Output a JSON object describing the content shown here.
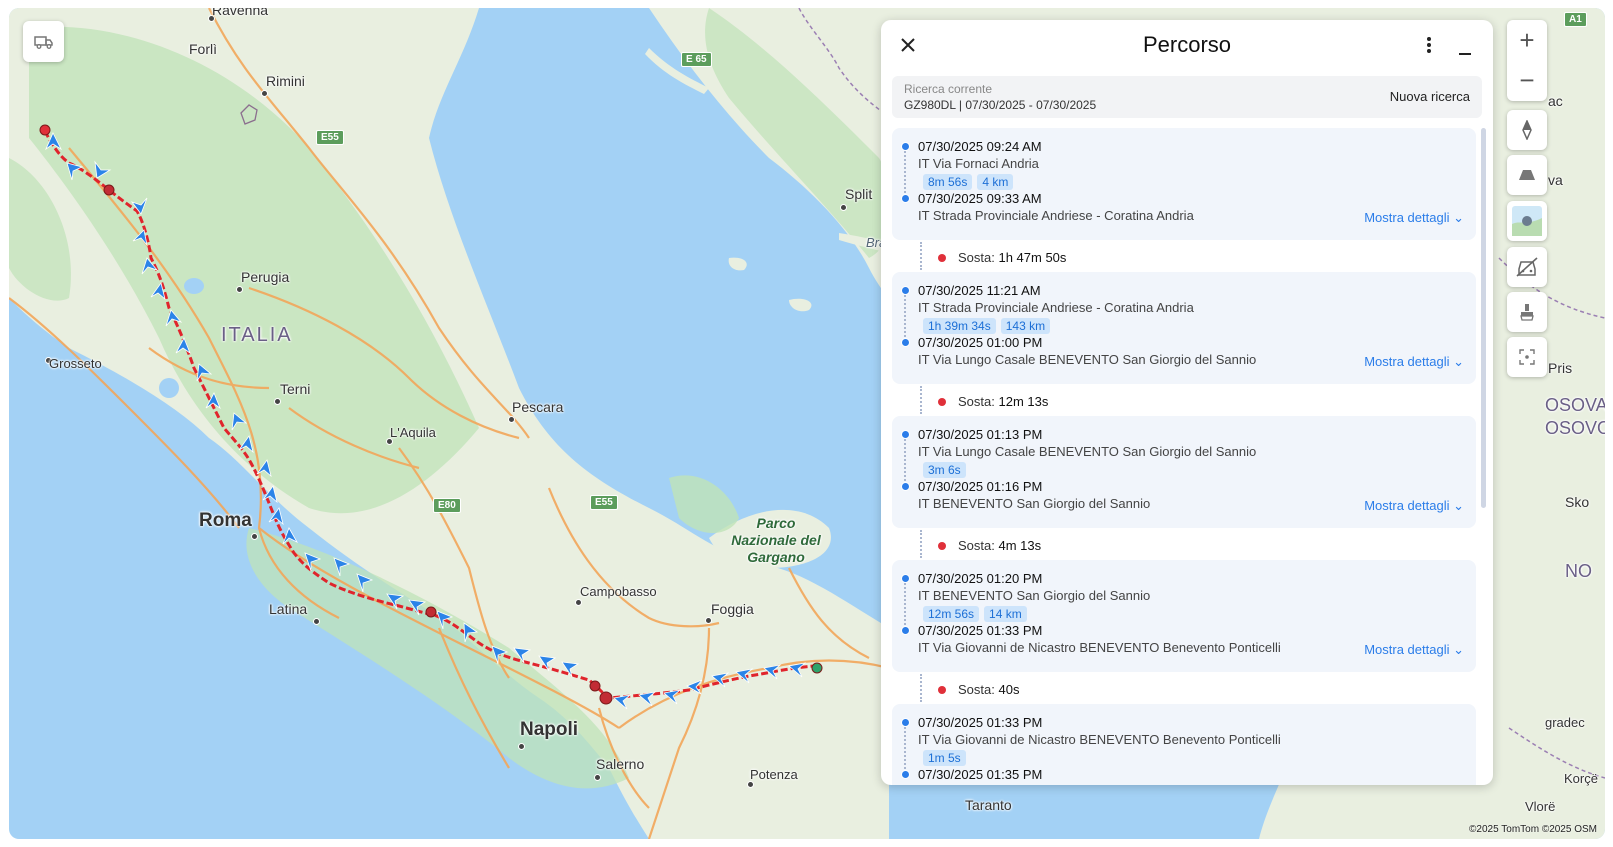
{
  "map": {
    "labels": {
      "ravenna": "Ravenna",
      "forli": "Forlì",
      "rimini": "Rimini",
      "perugia": "Perugia",
      "italia": "ITALIA",
      "grosseto": "Grosseto",
      "terni": "Terni",
      "laquila": "L'Aquila",
      "pescara": "Pescara",
      "roma": "Roma",
      "latina": "Latina",
      "campobasso": "Campobasso",
      "foggia": "Foggia",
      "napoli": "Napoli",
      "salerno": "Salerno",
      "potenza": "Potenza",
      "taranto": "Taranto",
      "split": "Split",
      "park": "Parco Nazionale del Gargano",
      "bra": "Bra",
      "edge_ac": "ac",
      "edge_va": "va",
      "edge_pris": "Pris",
      "edge_osova": "OSOVA",
      "edge_osovo": "OSOVO",
      "edge_sko": "Sko",
      "edge_no": "NO",
      "edge_gradec": "gradec",
      "edge_korce": "Korçë",
      "edge_vlore": "Vlorë",
      "edge_a1": "A1"
    },
    "roads": {
      "e65": "E 65",
      "e55_north": "E55",
      "e80": "E80",
      "e55_south": "E55"
    },
    "attribution": "©2025 TomTom  ©2025 OSM",
    "colors": {
      "sea": "#a3d1f5",
      "land": "#e9efe0",
      "forest": "#bfe3b8",
      "route": "#e0242c",
      "arrow": "#2b84e8"
    }
  },
  "controls": {
    "zoom_in": "+",
    "zoom_out": "−"
  },
  "panel": {
    "title": "Percorso",
    "search": {
      "label": "Ricerca corrente",
      "value": "GZ980DL | 07/30/2025 - 07/30/2025",
      "new_search": "Nuova ricerca"
    },
    "trips": [
      {
        "start_time": "07/30/2025 09:24 AM",
        "start_addr": "IT Via Fornaci Andria",
        "duration": "8m 56s",
        "distance": "4 km",
        "end_time": "07/30/2025 09:33 AM",
        "end_addr": "IT Strada Provinciale Andriese - Coratina Andria",
        "details": "Mostra dettagli"
      },
      {
        "start_time": "07/30/2025 11:21 AM",
        "start_addr": "IT Strada Provinciale Andriese - Coratina Andria",
        "duration": "1h 39m 34s",
        "distance": "143 km",
        "end_time": "07/30/2025 01:00 PM",
        "end_addr": "IT Via Lungo Casale BENEVENTO San Giorgio del Sannio",
        "details": "Mostra dettagli"
      },
      {
        "start_time": "07/30/2025 01:13 PM",
        "start_addr": "IT Via Lungo Casale BENEVENTO San Giorgio del Sannio",
        "duration": "3m 6s",
        "distance": "",
        "end_time": "07/30/2025 01:16 PM",
        "end_addr": "IT  BENEVENTO San Giorgio del Sannio",
        "details": "Mostra dettagli"
      },
      {
        "start_time": "07/30/2025 01:20 PM",
        "start_addr": "IT  BENEVENTO San Giorgio del Sannio",
        "duration": "12m 56s",
        "distance": "14 km",
        "end_time": "07/30/2025 01:33 PM",
        "end_addr": "IT Via Giovanni de Nicastro BENEVENTO Benevento Ponticelli",
        "details": "Mostra dettagli"
      },
      {
        "start_time": "07/30/2025 01:33 PM",
        "start_addr": "IT Via Giovanni de Nicastro BENEVENTO Benevento Ponticelli",
        "duration": "1m 5s",
        "distance": "",
        "end_time": "07/30/2025 01:35 PM",
        "end_addr": "",
        "details": ""
      }
    ],
    "stops": [
      {
        "label": "Sosta:",
        "value": "1h 47m 50s"
      },
      {
        "label": "Sosta:",
        "value": "12m 13s"
      },
      {
        "label": "Sosta:",
        "value": "4m 13s"
      },
      {
        "label": "Sosta:",
        "value": "40s"
      }
    ]
  }
}
